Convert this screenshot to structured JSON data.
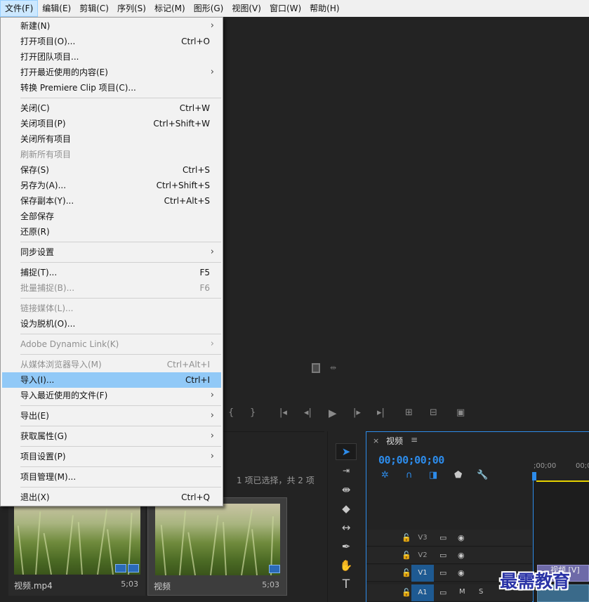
{
  "menubar": {
    "items": [
      "文件(F)",
      "编辑(E)",
      "剪辑(C)",
      "序列(S)",
      "标记(M)",
      "图形(G)",
      "视图(V)",
      "窗口(W)",
      "帮助(H)"
    ]
  },
  "file_menu": {
    "items": [
      {
        "label": "新建(N)",
        "shortcut": "",
        "arrow": "›"
      },
      {
        "label": "打开项目(O)...",
        "shortcut": "Ctrl+O",
        "arrow": ""
      },
      {
        "label": "打开团队项目...",
        "shortcut": "",
        "arrow": ""
      },
      {
        "label": "打开最近使用的内容(E)",
        "shortcut": "",
        "arrow": "›"
      },
      {
        "label": "转换 Premiere Clip 项目(C)...",
        "shortcut": "",
        "arrow": ""
      },
      {
        "label": "关闭(C)",
        "shortcut": "Ctrl+W",
        "arrow": ""
      },
      {
        "label": "关闭项目(P)",
        "shortcut": "Ctrl+Shift+W",
        "arrow": ""
      },
      {
        "label": "关闭所有项目",
        "shortcut": "",
        "arrow": ""
      },
      {
        "label": "刷新所有项目",
        "shortcut": "",
        "arrow": "",
        "disabled": true
      },
      {
        "label": "保存(S)",
        "shortcut": "Ctrl+S",
        "arrow": ""
      },
      {
        "label": "另存为(A)...",
        "shortcut": "Ctrl+Shift+S",
        "arrow": ""
      },
      {
        "label": "保存副本(Y)...",
        "shortcut": "Ctrl+Alt+S",
        "arrow": ""
      },
      {
        "label": "全部保存",
        "shortcut": "",
        "arrow": ""
      },
      {
        "label": "还原(R)",
        "shortcut": "",
        "arrow": ""
      },
      {
        "label": "同步设置",
        "shortcut": "",
        "arrow": "›"
      },
      {
        "label": "捕捉(T)...",
        "shortcut": "F5",
        "arrow": ""
      },
      {
        "label": "批量捕捉(B)...",
        "shortcut": "F6",
        "arrow": "",
        "disabled": true
      },
      {
        "label": "链接媒体(L)...",
        "shortcut": "",
        "arrow": "",
        "disabled": true
      },
      {
        "label": "设为脱机(O)...",
        "shortcut": "",
        "arrow": ""
      },
      {
        "label": "Adobe Dynamic Link(K)",
        "shortcut": "",
        "arrow": "›",
        "disabled": true
      },
      {
        "label": "从媒体浏览器导入(M)",
        "shortcut": "Ctrl+Alt+I",
        "arrow": "",
        "disabled": true
      },
      {
        "label": "导入(I)...",
        "shortcut": "Ctrl+I",
        "arrow": "",
        "highlighted": true
      },
      {
        "label": "导入最近使用的文件(F)",
        "shortcut": "",
        "arrow": "›"
      },
      {
        "label": "导出(E)",
        "shortcut": "",
        "arrow": "›"
      },
      {
        "label": "获取属性(G)",
        "shortcut": "",
        "arrow": "›"
      },
      {
        "label": "项目设置(P)",
        "shortcut": "",
        "arrow": "›"
      },
      {
        "label": "项目管理(M)...",
        "shortcut": "",
        "arrow": ""
      },
      {
        "label": "退出(X)",
        "shortcut": "Ctrl+Q",
        "arrow": ""
      }
    ]
  },
  "project_panel": {
    "status": "1 项已选择，共 2 项",
    "clips": [
      {
        "name": "视频.mp4",
        "duration": "5;03"
      },
      {
        "name": "视频",
        "duration": "5;03"
      }
    ]
  },
  "timeline": {
    "tab": "视频",
    "close": "×",
    "menu": "≡",
    "timecode": "00;00;00;00",
    "ruler_labels": [
      ";00;00",
      "00;0"
    ],
    "tracks": [
      {
        "name": "V3",
        "kind": "video",
        "target": false
      },
      {
        "name": "V2",
        "kind": "video",
        "target": false
      },
      {
        "name": "V1",
        "kind": "video",
        "target": true
      },
      {
        "name": "A1",
        "kind": "audio",
        "target": true,
        "m": "M",
        "s": "S"
      }
    ],
    "clip_label": "视频 [V]"
  },
  "watermark": "最需教育",
  "colors": {
    "accent": "#2d8ceb",
    "menu_highlight": "#91c9f7",
    "track_target": "#1e5a92",
    "clip_video": "#6e6aa8",
    "workbar": "#e6d200",
    "watermark": "#2a33a6"
  }
}
